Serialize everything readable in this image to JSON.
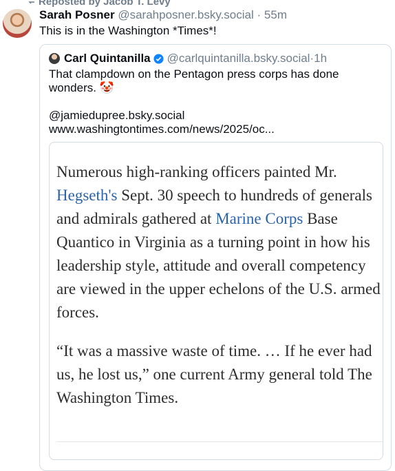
{
  "repost": {
    "label": "Reposted by Jacob T. Levy",
    "icon": "repost-icon"
  },
  "post": {
    "author_name": "Sarah Posner",
    "author_handle": "@sarahposner.bsky.social",
    "separator": "·",
    "time": "55m",
    "text": "This is in the Washington *Times*!"
  },
  "quote": {
    "author_name": "Carl Quintanilla",
    "verified": true,
    "author_handle": "@carlquintanilla.bsky.social",
    "separator": "·",
    "time": "1h",
    "text_line1": "That clampdown on the Pentagon press corps has done wonders. 🤡",
    "mention": "@jamiedupree.bsky.social",
    "link": "www.washingtontimes.com/news/2025/oc...",
    "image_text": {
      "para1_before": "Numerous high-ranking officers painted Mr. ",
      "para1_link1": "Hegseth's",
      "para1_mid": " Sept. 30 speech to hundreds of generals and admirals gathered at ",
      "para1_link2": "Marine Corps",
      "para1_after": " Base Quantico in Virginia as a turning point in how his leadership style, attitude and overall competency are viewed in the upper echelons of the U.S. armed forces.",
      "para2": "“It was a massive waste of time. … If he ever had us, he lost us,” one current Army general told The Washington Times."
    }
  },
  "colors": {
    "muted": "#6f7d8c",
    "link": "#2a63a8",
    "verified": "#1083fe",
    "border": "#d4dbe2"
  }
}
